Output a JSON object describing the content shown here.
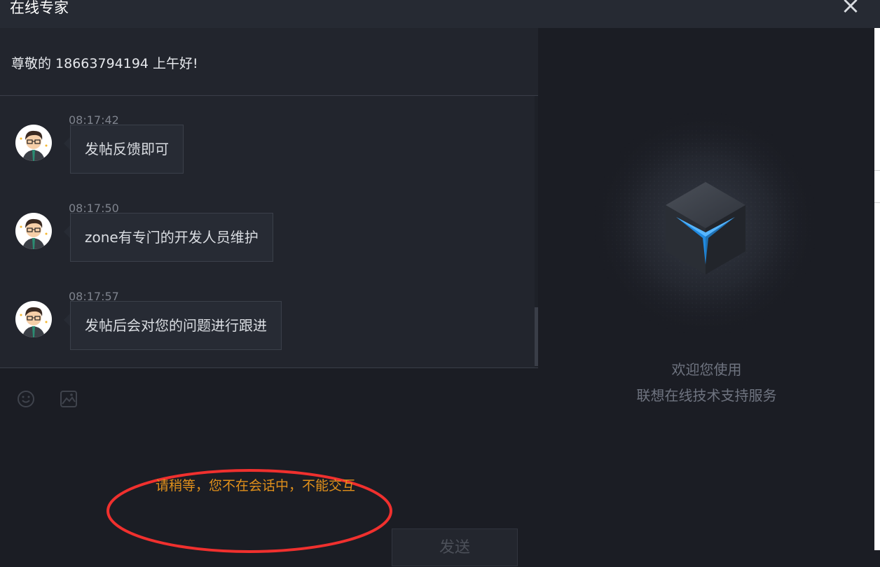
{
  "window": {
    "title": "在线专家"
  },
  "header": {
    "greeting": "尊敬的 18663794194 上午好!"
  },
  "messages": [
    {
      "time": "08:17:42",
      "text": "发帖反馈即可"
    },
    {
      "time": "08:17:50",
      "text": "zone有专门的开发人员维护"
    },
    {
      "time": "08:17:57",
      "text": "发帖后会对您的问题进行跟进"
    }
  ],
  "toolbar": {
    "emoji_icon": "smiley-icon",
    "image_icon": "image-icon"
  },
  "notice": "请稍等，您不在会话中，不能交互",
  "send_label": "发送",
  "welcome": {
    "line1": "欢迎您使用",
    "line2": "联想在线技术支持服务"
  },
  "colors": {
    "accent_blue": "#1e9bff",
    "notice_orange": "#e0901b",
    "annotation_red": "#f0302e"
  }
}
